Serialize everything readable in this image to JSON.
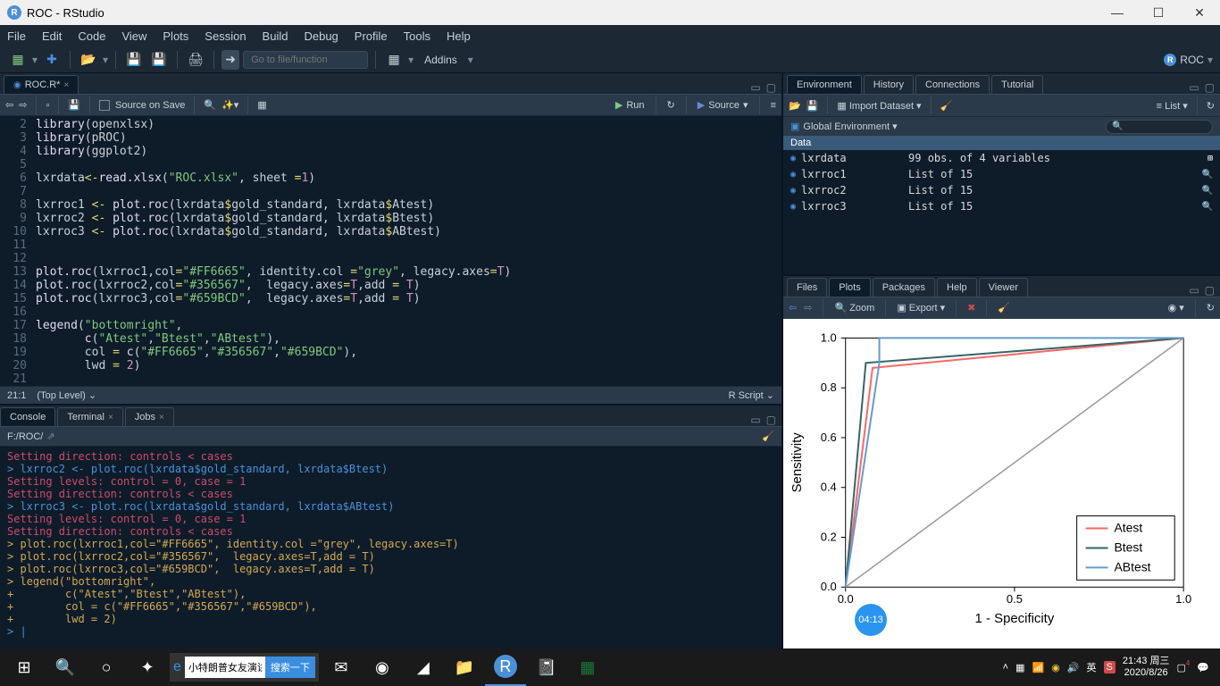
{
  "window": {
    "title": "ROC - RStudio"
  },
  "menu": [
    "File",
    "Edit",
    "Code",
    "View",
    "Plots",
    "Session",
    "Build",
    "Debug",
    "Profile",
    "Tools",
    "Help"
  ],
  "toolbar": {
    "goto_placeholder": "Go to file/function",
    "addins": "Addins",
    "project": "ROC"
  },
  "source": {
    "tab": "ROC.R*",
    "source_on_save": "Source on Save",
    "run": "Run",
    "source_btn": "Source",
    "cursor": "21:1",
    "scope": "(Top Level)",
    "lang": "R Script"
  },
  "code_lines": [
    {
      "n": 2,
      "html": "<span class='tok-fn'>library</span>(openxlsx)"
    },
    {
      "n": 3,
      "html": "<span class='tok-fn'>library</span>(pROC)"
    },
    {
      "n": 4,
      "html": "<span class='tok-fn'>library</span>(ggplot2)"
    },
    {
      "n": 5,
      "html": ""
    },
    {
      "n": 6,
      "html": "lxrdata<span class='tok-op'>&lt;-</span><span class='tok-fn'>read.xlsx</span>(<span class='tok-str'>\"ROC.xlsx\"</span>, sheet <span class='tok-op'>=</span><span class='tok-num'>1</span>)"
    },
    {
      "n": 7,
      "html": ""
    },
    {
      "n": 8,
      "html": "lxrroc1 <span class='tok-op'>&lt;-</span> <span class='tok-fn'>plot.roc</span>(lxrdata<span class='tok-op'>$</span>gold_standard, lxrdata<span class='tok-op'>$</span>Atest)"
    },
    {
      "n": 9,
      "html": "lxrroc2 <span class='tok-op'>&lt;-</span> <span class='tok-fn'>plot.roc</span>(lxrdata<span class='tok-op'>$</span>gold_standard, lxrdata<span class='tok-op'>$</span>Btest)"
    },
    {
      "n": 10,
      "html": "lxrroc3 <span class='tok-op'>&lt;-</span> <span class='tok-fn'>plot.roc</span>(lxrdata<span class='tok-op'>$</span>gold_standard, lxrdata<span class='tok-op'>$</span>ABtest)"
    },
    {
      "n": 11,
      "html": ""
    },
    {
      "n": 12,
      "html": ""
    },
    {
      "n": 13,
      "html": "<span class='tok-fn'>plot.roc</span>(lxrroc1,col<span class='tok-op'>=</span><span class='tok-str'>\"#FF6665\"</span>, identity.col <span class='tok-op'>=</span><span class='tok-str'>\"grey\"</span>, legacy.axes<span class='tok-op'>=</span><span class='tok-num'>T</span>)"
    },
    {
      "n": 14,
      "html": "<span class='tok-fn'>plot.roc</span>(lxrroc2,col<span class='tok-op'>=</span><span class='tok-str'>\"#356567\"</span>,  legacy.axes<span class='tok-op'>=</span><span class='tok-num'>T</span>,add <span class='tok-op'>=</span> <span class='tok-num'>T</span>)"
    },
    {
      "n": 15,
      "html": "<span class='tok-fn'>plot.roc</span>(lxrroc3,col<span class='tok-op'>=</span><span class='tok-str'>\"#659BCD\"</span>,  legacy.axes<span class='tok-op'>=</span><span class='tok-num'>T</span>,add <span class='tok-op'>=</span> <span class='tok-num'>T</span>)"
    },
    {
      "n": 16,
      "html": ""
    },
    {
      "n": 17,
      "html": "<span class='tok-fn'>legend</span>(<span class='tok-str'>\"bottomright\"</span>,"
    },
    {
      "n": 18,
      "html": "       <span class='tok-fn'>c</span>(<span class='tok-str'>\"Atest\"</span>,<span class='tok-str'>\"Btest\"</span>,<span class='tok-str'>\"ABtest\"</span>),"
    },
    {
      "n": 19,
      "html": "       col <span class='tok-op'>=</span> <span class='tok-fn'>c</span>(<span class='tok-str'>\"#FF6665\"</span>,<span class='tok-str'>\"#356567\"</span>,<span class='tok-str'>\"#659BCD\"</span>),"
    },
    {
      "n": 20,
      "html": "       lwd <span class='tok-op'>=</span> <span class='tok-num'>2</span>)"
    },
    {
      "n": 21,
      "html": ""
    }
  ],
  "console": {
    "tabs": [
      "Console",
      "Terminal",
      "Jobs"
    ],
    "path": "F:/ROC/",
    "lines": [
      {
        "cls": "c-red",
        "t": "Setting direction: controls < cases"
      },
      {
        "cls": "c-blue",
        "t": "> lxrroc2 <- plot.roc(lxrdata$gold_standard, lxrdata$Btest)"
      },
      {
        "cls": "c-red",
        "t": "Setting levels: control = 0, case = 1"
      },
      {
        "cls": "c-red",
        "t": "Setting direction: controls < cases"
      },
      {
        "cls": "c-blue",
        "t": "> lxrroc3 <- plot.roc(lxrdata$gold_standard, lxrdata$ABtest)"
      },
      {
        "cls": "c-red",
        "t": "Setting levels: control = 0, case = 1"
      },
      {
        "cls": "c-red",
        "t": "Setting direction: controls < cases"
      },
      {
        "cls": "c-yellow",
        "t": "> plot.roc(lxrroc1,col=\"#FF6665\", identity.col =\"grey\", legacy.axes=T)"
      },
      {
        "cls": "c-yellow",
        "t": "> plot.roc(lxrroc2,col=\"#356567\",  legacy.axes=T,add = T)"
      },
      {
        "cls": "c-yellow",
        "t": "> plot.roc(lxrroc3,col=\"#659BCD\",  legacy.axes=T,add = T)"
      },
      {
        "cls": "c-yellow",
        "t": "> legend(\"bottomright\","
      },
      {
        "cls": "c-yellow",
        "t": "+        c(\"Atest\",\"Btest\",\"ABtest\"),"
      },
      {
        "cls": "c-yellow",
        "t": "+        col = c(\"#FF6665\",\"#356567\",\"#659BCD\"),"
      },
      {
        "cls": "c-yellow",
        "t": "+        lwd = 2)"
      },
      {
        "cls": "c-blue",
        "t": "> |"
      }
    ]
  },
  "env": {
    "tabs": [
      "Environment",
      "History",
      "Connections",
      "Tutorial"
    ],
    "import": "Import Dataset",
    "list_mode": "List",
    "scope": "Global Environment",
    "section": "Data",
    "items": [
      {
        "name": "lxrdata",
        "val": "99 obs. of 4 variables",
        "icon": "grid"
      },
      {
        "name": "lxrroc1",
        "val": "List of 15",
        "icon": "search"
      },
      {
        "name": "lxrroc2",
        "val": "List of 15",
        "icon": "search"
      },
      {
        "name": "lxrroc3",
        "val": "List of 15",
        "icon": "search"
      }
    ]
  },
  "plots": {
    "tabs": [
      "Files",
      "Plots",
      "Packages",
      "Help",
      "Viewer"
    ],
    "zoom": "Zoom",
    "export": "Export",
    "timer": "04:13"
  },
  "chart_data": {
    "type": "line",
    "title": "",
    "xlabel": "1 - Specificity",
    "ylabel": "Sensitivity",
    "xlim": [
      0,
      1
    ],
    "ylim": [
      0,
      1
    ],
    "xticks": [
      0.0,
      0.5,
      1.0
    ],
    "yticks": [
      0.0,
      0.2,
      0.4,
      0.6,
      0.8,
      1.0
    ],
    "identity_line": [
      [
        0,
        0
      ],
      [
        1,
        1
      ]
    ],
    "series": [
      {
        "name": "Atest",
        "color": "#FF6665",
        "points": [
          [
            0,
            0
          ],
          [
            0.08,
            0.88
          ],
          [
            1,
            1
          ]
        ]
      },
      {
        "name": "Btest",
        "color": "#356567",
        "points": [
          [
            0,
            0
          ],
          [
            0.06,
            0.9
          ],
          [
            1,
            1
          ]
        ]
      },
      {
        "name": "ABtest",
        "color": "#659BCD",
        "points": [
          [
            0,
            0
          ],
          [
            0.1,
            0.9
          ],
          [
            0.1,
            1.0
          ],
          [
            1,
            1
          ]
        ]
      }
    ],
    "legend_position": "bottomright"
  },
  "taskbar": {
    "search_text": "小特朗普女友演讲",
    "search_btn": "搜索一下",
    "clock_time": "21:43",
    "clock_day": "周三",
    "clock_date": "2020/8/26",
    "ime": "英"
  }
}
